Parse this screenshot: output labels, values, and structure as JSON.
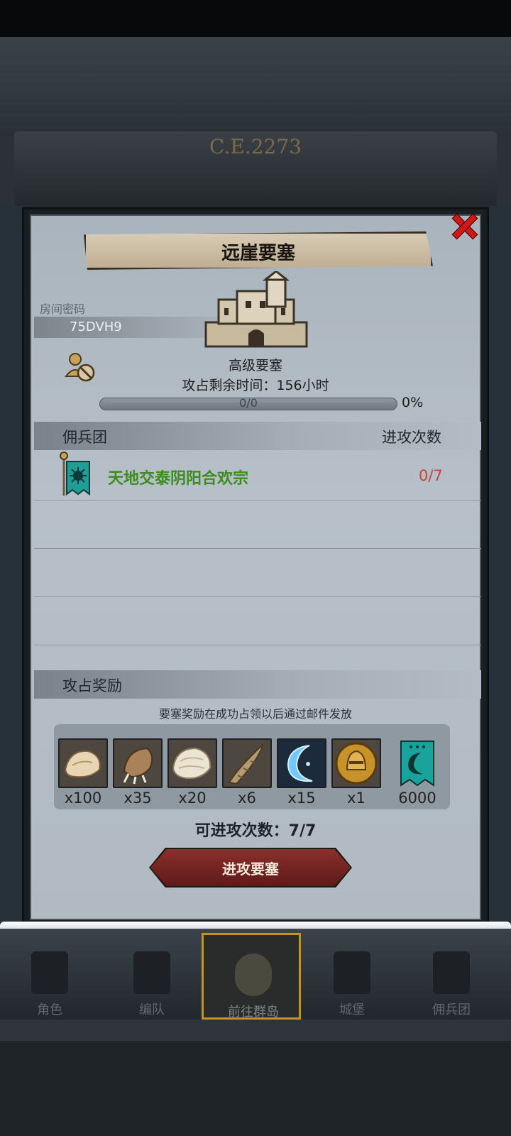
{
  "header": {
    "era": "C.E.2273"
  },
  "dialog": {
    "title": "远崖要塞",
    "room_label": "房间密码",
    "room_code": "75DVH9",
    "fort_type": "高级要塞",
    "remaining_time": "攻占剩余时间：156小时",
    "progress_text": "0/0",
    "progress_percent": "0%",
    "progress_value": 0
  },
  "mercenary": {
    "header_title": "佣兵团",
    "header_attacks": "进攻次数",
    "rows": [
      {
        "name": "天地交泰阴阳合欢宗",
        "attacks": "0/7"
      }
    ]
  },
  "rewards": {
    "title": "攻占奖励",
    "note": "要塞奖励在成功占领以后通过邮件发放",
    "items": [
      {
        "icon": "fur-pelt-icon",
        "qty": "x100"
      },
      {
        "icon": "claw-icon",
        "qty": "x35"
      },
      {
        "icon": "white-fur-icon",
        "qty": "x20"
      },
      {
        "icon": "horn-icon",
        "qty": "x6"
      },
      {
        "icon": "blue-crescent-icon",
        "qty": "x15"
      },
      {
        "icon": "knight-helmet-coin-icon",
        "qty": "x1"
      },
      {
        "icon": "guild-banner-icon",
        "qty": "6000"
      }
    ]
  },
  "attack_count": "可进攻次数：7/7",
  "attack_button": "进攻要塞",
  "nav": [
    {
      "label": "角色",
      "icon": "character-icon"
    },
    {
      "label": "编队",
      "icon": "formation-icon"
    },
    {
      "label": "前往群岛",
      "icon": "globe-compass-icon"
    },
    {
      "label": "城堡",
      "icon": "castle-icon"
    },
    {
      "label": "佣兵团",
      "icon": "mercenary-icon"
    }
  ],
  "colors": {
    "guild_name": "#3c8c1e",
    "attacks_red": "#c0463e",
    "close_red": "#d01818",
    "button_red": "#8b2f2b",
    "active_nav_gold": "#c39324"
  }
}
